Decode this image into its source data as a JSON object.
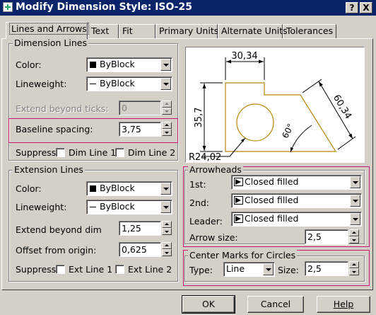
{
  "window": {
    "title": "Modify Dimension Style: ISO-25",
    "help_button": "?",
    "close_button": "X"
  },
  "tabs": [
    {
      "label": "Lines and Arrows",
      "active": true
    },
    {
      "label": "Text"
    },
    {
      "label": "Fit"
    },
    {
      "label": "Primary Units"
    },
    {
      "label": "Alternate Units"
    },
    {
      "label": "Tolerances"
    }
  ],
  "dimension_lines": {
    "title": "Dimension Lines",
    "color_label": "Color:",
    "color_value": "ByBlock",
    "lineweight_label": "Lineweight:",
    "lineweight_value": "ByBlock",
    "extend_label": "Extend beyond ticks:",
    "extend_value": "0",
    "baseline_label": "Baseline spacing:",
    "baseline_value": "3,75",
    "suppress_label": "Suppress:",
    "dim_line_1": "Dim Line 1",
    "dim_line_2": "Dim Line 2"
  },
  "extension_lines": {
    "title": "Extension Lines",
    "color_label": "Color:",
    "color_value": "ByBlock",
    "lineweight_label": "Lineweight:",
    "lineweight_value": "ByBlock",
    "extend_label": "Extend beyond dim",
    "extend_value": "1,25",
    "offset_label": "Offset from origin:",
    "offset_value": "0,625",
    "suppress_label": "Suppress:",
    "ext_line_1": "Ext Line 1",
    "ext_line_2": "Ext Line 2"
  },
  "preview": {
    "dim_top": "30,34",
    "dim_left": "35,7",
    "dim_diag": "60,34",
    "dim_angle": "60°",
    "dim_radius": "R24,02"
  },
  "arrowheads": {
    "title": "Arrowheads",
    "first_label": "1st:",
    "first_value": "Closed filled",
    "second_label": "2nd:",
    "second_value": "Closed filled",
    "leader_label": "Leader:",
    "leader_value": "Closed filled",
    "size_label": "Arrow size:",
    "size_value": "2,5"
  },
  "center_marks": {
    "title": "Center Marks for Circles",
    "type_label": "Type:",
    "type_value": "Line",
    "size_label": "Size:",
    "size_value": "2,5"
  },
  "buttons": {
    "ok": "OK",
    "cancel": "Cancel",
    "help": "Help"
  },
  "colors": {
    "titlebar": "#0a246a",
    "face": "#d4d0c8",
    "highlight": "#cc1177",
    "drawing": "#b8860b"
  }
}
